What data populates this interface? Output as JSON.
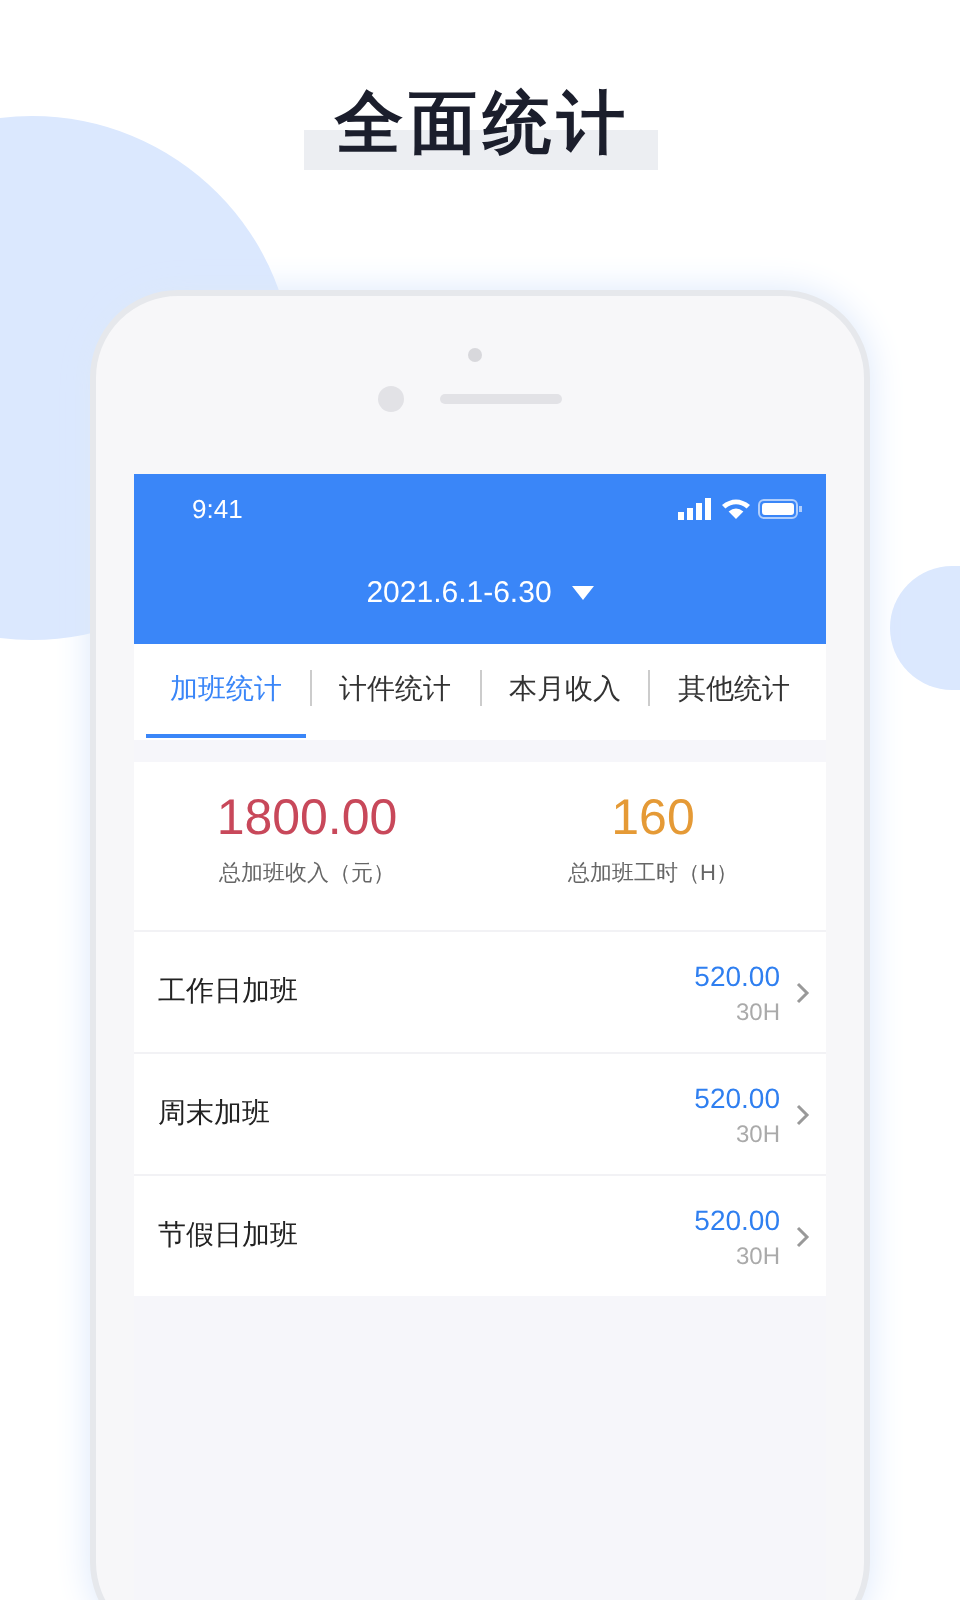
{
  "headline": "全面统计",
  "status_bar": {
    "time": "9:41"
  },
  "date_range": "2021.6.1-6.30",
  "tabs": [
    {
      "label": "加班统计",
      "selected": true
    },
    {
      "label": "计件统计",
      "selected": false
    },
    {
      "label": "本月收入",
      "selected": false
    },
    {
      "label": "其他统计",
      "selected": false
    }
  ],
  "summary": [
    {
      "value": "1800.00",
      "label": "总加班收入（元）",
      "color": "#c8485a"
    },
    {
      "value": "160",
      "label": "总加班工时（H）",
      "color": "#e59a36"
    }
  ],
  "rows": [
    {
      "label": "工作日加班",
      "amount": "520.00",
      "hours": "30H"
    },
    {
      "label": "周末加班",
      "amount": "520.00",
      "hours": "30H"
    },
    {
      "label": "节假日加班",
      "amount": "520.00",
      "hours": "30H"
    }
  ]
}
